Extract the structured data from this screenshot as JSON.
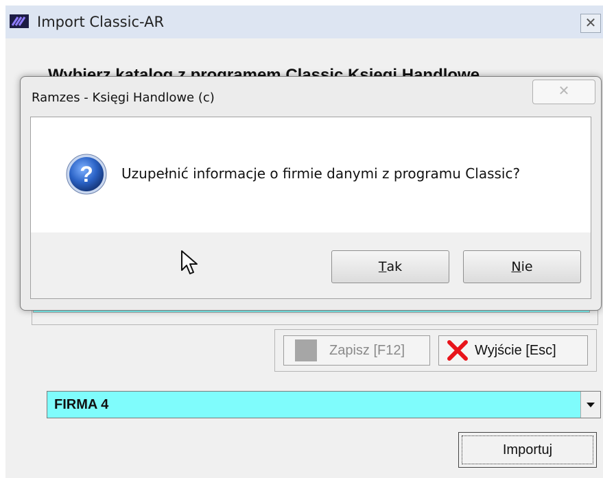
{
  "main_window": {
    "title": "Import Classic-AR",
    "close_glyph": "✕",
    "heading": "Wybierz katalog z programem Classic Księgi Handlowe"
  },
  "toolbar": {
    "save_label": "Zapisz  [F12]",
    "exit_label": "Wyjście  [Esc]"
  },
  "company_select": {
    "value": "FIRMA 4"
  },
  "import_button": {
    "label": "Importuj"
  },
  "dialog": {
    "title": "Ramzes - Księgi Handlowe (c)",
    "close_glyph": "✕",
    "message": "Uzupełnić informacje o firmie danymi z programu Classic?",
    "yes_mnemonic": "T",
    "yes_rest": "ak",
    "no_mnemonic": "N",
    "no_rest": "ie"
  },
  "colors": {
    "field_cyan": "#7ffcfc",
    "titlebar": "#dde5f2",
    "exit_red": "#e8141b",
    "question_blue": "#2b63c6"
  },
  "icons": [
    "app-logo-icon",
    "question-icon",
    "close-icon",
    "exit-x-icon",
    "save-icon",
    "mouse-cursor-icon",
    "chevron-down-icon"
  ]
}
